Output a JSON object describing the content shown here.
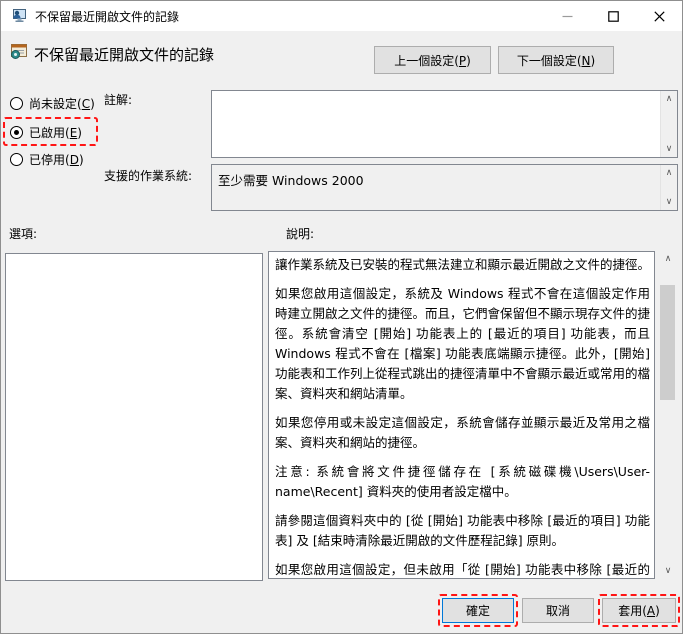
{
  "window": {
    "title": "不保留最近開啟文件的記錄"
  },
  "icons": {
    "app_icon": "group-policy-app-icon",
    "setting_icon": "group-policy-setting-icon",
    "minimize": "minimize-icon",
    "maximize": "maximize-icon",
    "close": "close-icon",
    "scroll_up": "∧",
    "scroll_down": "∨"
  },
  "colors": {
    "annotation_red": "#ff1515",
    "focus_blue": "#0078d7",
    "button_face": "#e1e1e1",
    "dialog_background": "#f0f0f0"
  },
  "header": {
    "setting_title": "不保留最近開啟文件的記錄",
    "prev_button": {
      "text": "上一個設定(",
      "key": "P",
      "suffix": ")"
    },
    "next_button": {
      "text": "下一個設定(",
      "key": "N",
      "suffix": ")"
    }
  },
  "state_options": {
    "not_configured": {
      "text": "尚未設定(",
      "key": "C",
      "suffix": ")",
      "selected": false
    },
    "enabled": {
      "text": "已啟用(",
      "key": "E",
      "suffix": ")",
      "selected": true
    },
    "disabled": {
      "text": "已停用(",
      "key": "D",
      "suffix": ")",
      "selected": false
    }
  },
  "comment": {
    "label": "註解:",
    "value": ""
  },
  "supported": {
    "label": "支援的作業系統:",
    "value": "至少需要 Windows 2000"
  },
  "options": {
    "label": "選項:"
  },
  "help": {
    "label": "說明:",
    "paragraphs": [
      "讓作業系統及已安裝的程式無法建立和顯示最近開啟之文件的捷徑。",
      "如果您啟用這個設定，系統及 Windows 程式不會在這個設定作用時建立開啟之文件的捷徑。而且，它們會保留但不顯示現存文件的捷徑。系統會清空 [開始] 功能表上的 [最近的項目] 功能表，而且 Windows 程式不會在 [檔案] 功能表底端顯示捷徑。此外，[開始] 功能表和工作列上從程式跳出的捷徑清單中不會顯示最近或常用的檔案、資料夾和網站清單。",
      "如果您停用或未設定這個設定，系統會儲存並顯示最近及常用之檔案、資料夾和網站的捷徑。",
      "注意: 系統會將文件捷徑儲存在 [系統磁碟機\\Users\\User-name\\Recent] 資料夾的使用者設定檔中。",
      "請參閱這個資料夾中的 [從 [開始] 功能表中移除 [最近的項目] 功能表] 及 [結束時清除最近開啟的文件歷程記錄] 原則。",
      "如果您啟用這個設定，但未啟用「從 [開始] 功能表中移除 [最近的項目] 功能表」設定，則 [最近的項目] 功能表會出現在 [開始] 功能表上，但卻是空的。"
    ]
  },
  "footer": {
    "ok_label": "確定",
    "cancel_label": "取消",
    "apply": {
      "text": "套用(",
      "key": "A",
      "suffix": ")"
    }
  }
}
